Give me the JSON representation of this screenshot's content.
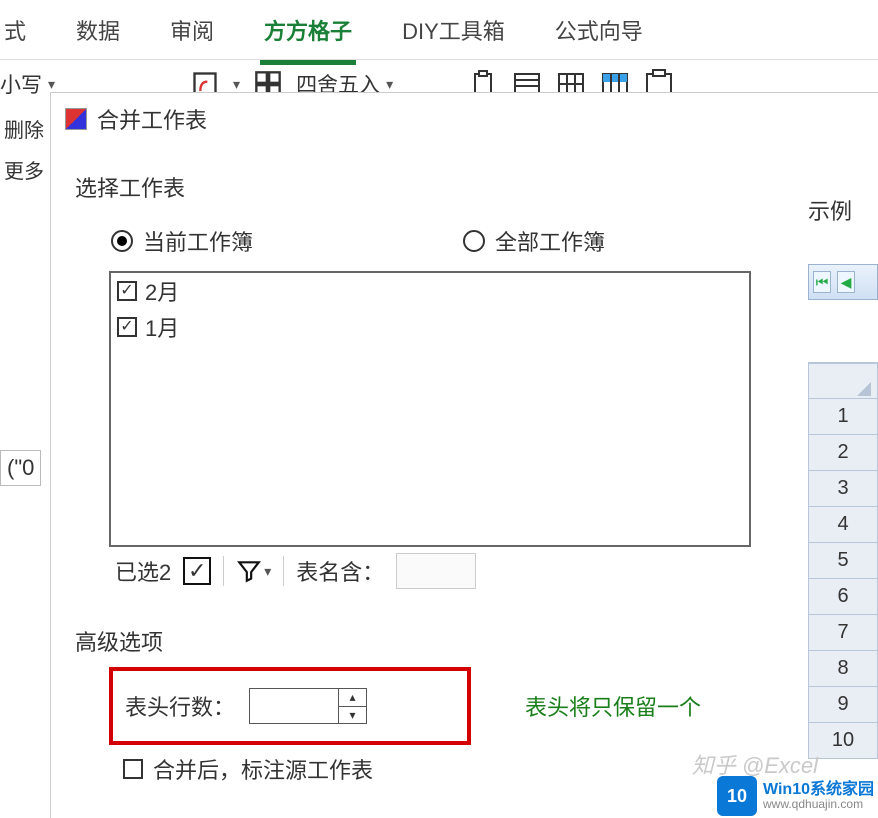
{
  "ribbon": {
    "tabs": [
      "式",
      "数据",
      "审阅",
      "方方格子",
      "DIY工具箱",
      "公式向导"
    ],
    "active_index": 3,
    "toolbar": {
      "case_item": "小写",
      "round_item": "四舍五入"
    }
  },
  "left_edge": {
    "l1": "删除",
    "l2": "更多"
  },
  "formula_fragment": "(\"0",
  "dialog": {
    "title": "合并工作表",
    "select_label": "选择工作表",
    "radios": {
      "current": "当前工作簿",
      "all": "全部工作簿",
      "selected": "current"
    },
    "sheets": [
      {
        "name": "2月",
        "checked": true
      },
      {
        "name": "1月",
        "checked": true
      }
    ],
    "selected_count_label": "已选2",
    "name_contains_label": "表名含：",
    "advanced_label": "高级选项",
    "header_rows_label": "表头行数：",
    "header_rows_value": "",
    "header_hint": "表头将只保留一个",
    "mark_source_label": "合并后，标注源工作表"
  },
  "example": {
    "label": "示例",
    "row_numbers": [
      1,
      2,
      3,
      4,
      5,
      6,
      7,
      8,
      9,
      10
    ]
  },
  "watermark": {
    "zhihu": "知乎 @Excel",
    "logo_num": "10",
    "logo_title": "Win10系统家园",
    "logo_url": "www.qdhuajin.com"
  }
}
